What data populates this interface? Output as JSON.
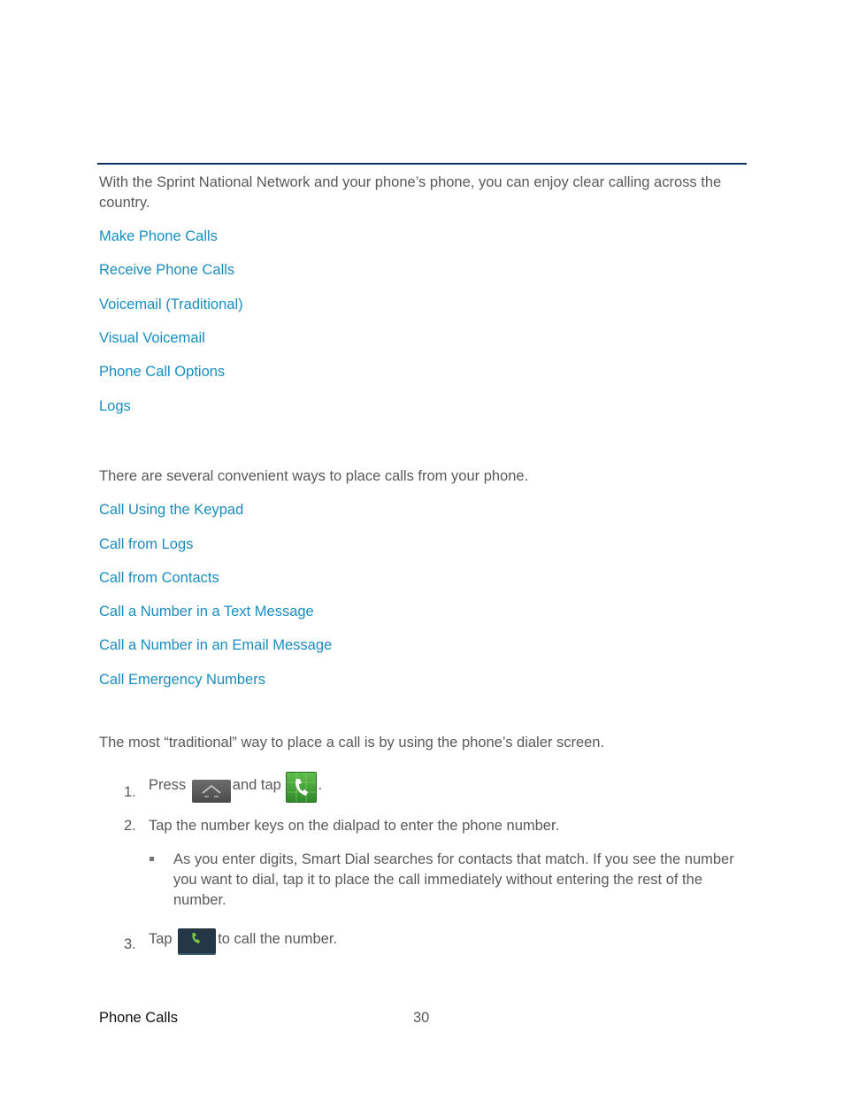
{
  "intro": "With the Sprint National Network and your phone’s phone, you can enjoy clear calling across the country.",
  "toc_links": [
    "Make Phone Calls",
    "Receive Phone Calls",
    "Voicemail (Traditional)",
    "Visual Voicemail",
    "Phone Call Options",
    "Logs"
  ],
  "make_calls_intro": "There are several convenient ways to place calls from your phone.",
  "make_calls_links": [
    "Call Using the Keypad",
    "Call from Logs",
    "Call from Contacts",
    "Call a Number in a Text Message",
    "Call a Number in an Email Message",
    "Call Emergency Numbers"
  ],
  "keypad_intro": "The most “traditional” way to place a call is by using the phone’s dialer screen.",
  "steps": [
    {
      "num": "1.",
      "pre": "Press",
      "mid": "and tap",
      "post": ".",
      "icons": [
        "home-key-icon",
        "phone-app-icon"
      ]
    },
    {
      "num": "2.",
      "text": "Tap the number keys on the dialpad to enter the phone number."
    },
    {
      "num": "3.",
      "pre": "Tap",
      "post": "to call the number.",
      "icons": [
        "dial-button-icon"
      ]
    }
  ],
  "bullet": "As you enter digits, Smart Dial searches for contacts that match. If you see the number you want to dial, tap it to place the call immediately without entering the rest of the number.",
  "footer": {
    "section": "Phone Calls",
    "page": "30"
  },
  "colors": {
    "link": "#1a8dbf",
    "rule": "#0f3160",
    "text": "#595959"
  }
}
